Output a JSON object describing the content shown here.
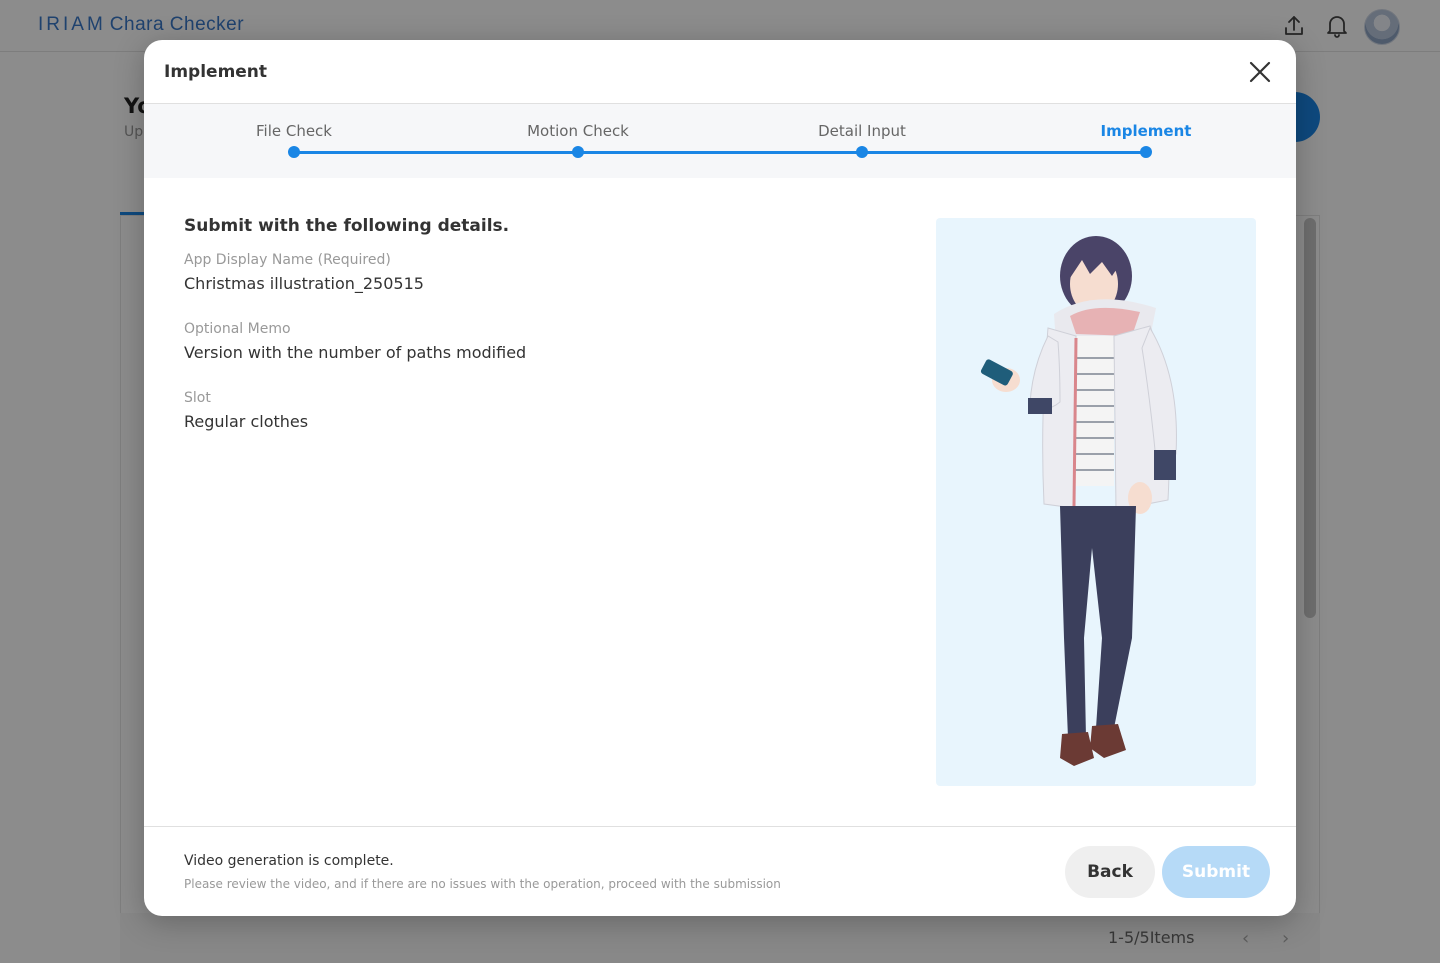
{
  "app": {
    "logo_part1": "IRIAM",
    "logo_part2": "Chara Checker",
    "page_title_partial": "Yo",
    "page_subtitle_partial": "Up",
    "pagination": "1-5/5Items"
  },
  "modal": {
    "title": "Implement",
    "steps": [
      {
        "label": "File Check",
        "state": "completed"
      },
      {
        "label": "Motion Check",
        "state": "completed"
      },
      {
        "label": "Detail Input",
        "state": "completed"
      },
      {
        "label": "Implement",
        "state": "active"
      }
    ],
    "heading": "Submit with the following details.",
    "fields": [
      {
        "label": "App Display Name (Required)",
        "value": "Christmas illustration_250515"
      },
      {
        "label": "Optional Memo",
        "value": "Version with the number of paths modified"
      },
      {
        "label": "Slot",
        "value": "Regular clothes"
      }
    ],
    "footer": {
      "message": "Video generation is complete.",
      "note": "Please review the video, and if there are no issues with the operation, proceed with the submission",
      "back_label": "Back",
      "submit_label": "Submit",
      "submit_enabled": false
    }
  },
  "colors": {
    "accent": "#1a86e5",
    "submit_disabled": "#b6daf7",
    "preview_bg": "#e8f5fd",
    "overlay": "rgba(0,0,0,0.45)"
  },
  "icons": [
    "upload-icon",
    "bell-icon",
    "close-icon",
    "chevron-left-icon",
    "chevron-right-icon"
  ]
}
